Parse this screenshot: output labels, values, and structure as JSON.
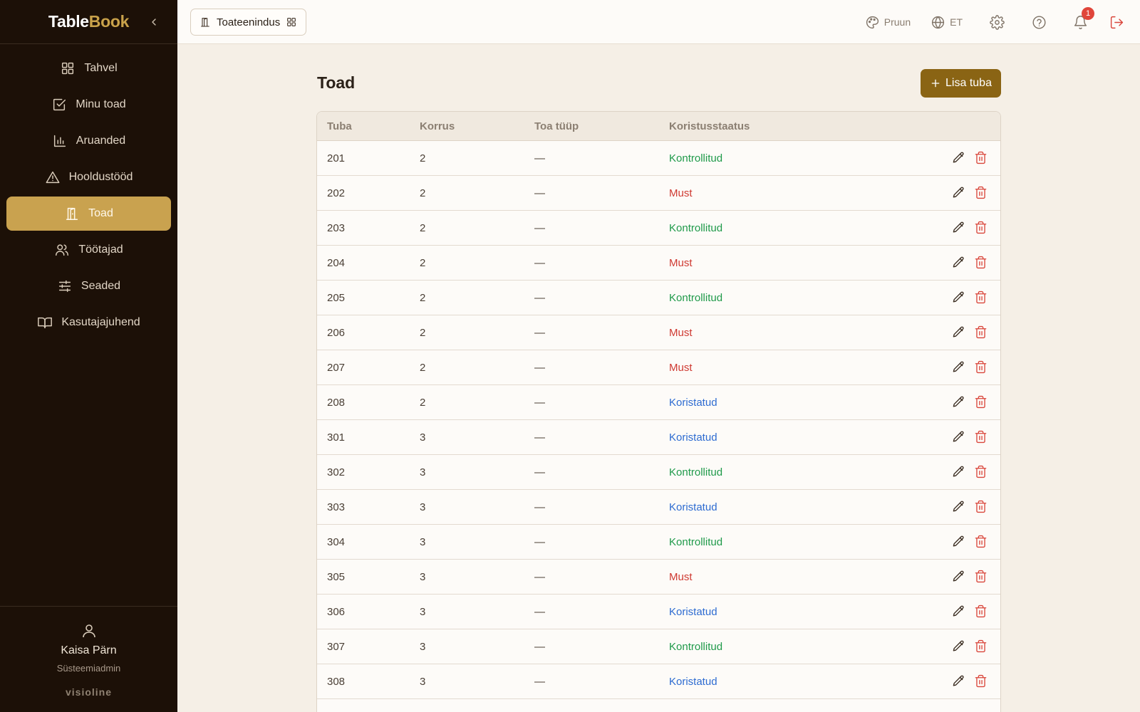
{
  "brand": {
    "part1": "Table",
    "part2": "Book"
  },
  "sidebar": {
    "items": [
      {
        "label": "Tahvel",
        "icon": "grid-icon",
        "active": false
      },
      {
        "label": "Minu toad",
        "icon": "check-square-icon",
        "active": false
      },
      {
        "label": "Aruanded",
        "icon": "bar-chart-icon",
        "active": false
      },
      {
        "label": "Hooldustööd",
        "icon": "warning-triangle-icon",
        "active": false
      },
      {
        "label": "Toad",
        "icon": "door-icon",
        "active": true
      },
      {
        "label": "Töötajad",
        "icon": "users-icon",
        "active": false
      },
      {
        "label": "Seaded",
        "icon": "sliders-icon",
        "active": false
      },
      {
        "label": "Kasutajajuhend",
        "icon": "book-icon",
        "active": false
      }
    ],
    "user": {
      "name": "Kaisa Pärn",
      "role": "Süsteemiadmin"
    },
    "company": "visioline"
  },
  "topbar": {
    "module": "Toateenindus",
    "theme": "Pruun",
    "language": "ET",
    "notifications": "1"
  },
  "main": {
    "title": "Toad",
    "add_button": "Lisa tuba",
    "columns": [
      "Tuba",
      "Korrus",
      "Toa tüüp",
      "Koristusstaatus"
    ],
    "rows": [
      {
        "room": "201",
        "floor": "2",
        "type": "—",
        "status": "Kontrollitud",
        "status_color": "green"
      },
      {
        "room": "202",
        "floor": "2",
        "type": "—",
        "status": "Must",
        "status_color": "red"
      },
      {
        "room": "203",
        "floor": "2",
        "type": "—",
        "status": "Kontrollitud",
        "status_color": "green"
      },
      {
        "room": "204",
        "floor": "2",
        "type": "—",
        "status": "Must",
        "status_color": "red"
      },
      {
        "room": "205",
        "floor": "2",
        "type": "—",
        "status": "Kontrollitud",
        "status_color": "green"
      },
      {
        "room": "206",
        "floor": "2",
        "type": "—",
        "status": "Must",
        "status_color": "red"
      },
      {
        "room": "207",
        "floor": "2",
        "type": "—",
        "status": "Must",
        "status_color": "red"
      },
      {
        "room": "208",
        "floor": "2",
        "type": "—",
        "status": "Koristatud",
        "status_color": "blue"
      },
      {
        "room": "301",
        "floor": "3",
        "type": "—",
        "status": "Koristatud",
        "status_color": "blue"
      },
      {
        "room": "302",
        "floor": "3",
        "type": "—",
        "status": "Kontrollitud",
        "status_color": "green"
      },
      {
        "room": "303",
        "floor": "3",
        "type": "—",
        "status": "Koristatud",
        "status_color": "blue"
      },
      {
        "room": "304",
        "floor": "3",
        "type": "—",
        "status": "Kontrollitud",
        "status_color": "green"
      },
      {
        "room": "305",
        "floor": "3",
        "type": "—",
        "status": "Must",
        "status_color": "red"
      },
      {
        "room": "306",
        "floor": "3",
        "type": "—",
        "status": "Koristatud",
        "status_color": "blue"
      },
      {
        "room": "307",
        "floor": "3",
        "type": "—",
        "status": "Kontrollitud",
        "status_color": "green"
      },
      {
        "room": "308",
        "floor": "3",
        "type": "—",
        "status": "Koristatud",
        "status_color": "blue"
      }
    ]
  },
  "colors": {
    "sidebar_bg": "#1c1007",
    "accent": "#c9a24f",
    "button": "#8a6414",
    "status_green": "#1f9a4a",
    "status_red": "#cf3a32",
    "status_blue": "#2d6bd1"
  }
}
